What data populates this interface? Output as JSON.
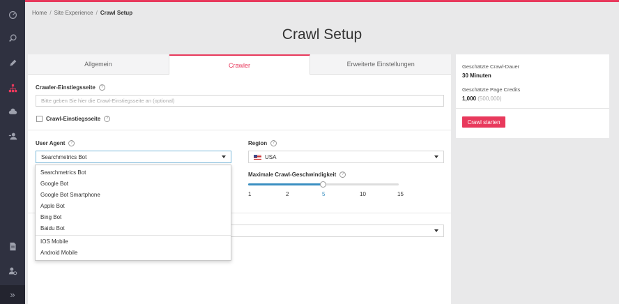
{
  "breadcrumb": {
    "home": "Home",
    "section": "Site Experience",
    "current": "Crawl Setup",
    "separator": "/"
  },
  "page": {
    "title": "Crawl Setup"
  },
  "tabs": [
    {
      "label": "Allgemein",
      "active": false
    },
    {
      "label": "Crawler",
      "active": true
    },
    {
      "label": "Erweiterte Einstellungen",
      "active": false
    }
  ],
  "form": {
    "entry_label": "Crawler-Einstiegsseite",
    "entry_placeholder": "Bitte geben Sie hier die Crawl-Einstiegsseite an (optional)",
    "entry_checkbox_label": "Crawl-Einstiegsseite",
    "help_glyph": "?",
    "user_agent_label": "User Agent",
    "user_agent_value": "Searchmetrics Bot",
    "region_label": "Region",
    "region_value": "USA",
    "speed_label": "Maximale Crawl-Geschwindigkeit",
    "speed_ticks": [
      "1",
      "2",
      "5",
      "10",
      "15"
    ],
    "speed_selected": "5"
  },
  "user_agent_options": [
    "Searchmetrics Bot",
    "Google Bot",
    "Google Bot Smartphone",
    "Apple Bot",
    "Bing Bot",
    "Baidu Bot",
    "IOS Mobile",
    "Android Mobile"
  ],
  "summary": {
    "duration_label": "Geschätzte Crawl-Dauer",
    "duration_value": "30 Minuten",
    "credits_label": "Geschätzte Page Credits",
    "credits_value": "1,000",
    "credits_max": "(500,000)",
    "start_button": "Crawl starten"
  },
  "sidebar": {
    "icons": [
      "speedometer-icon",
      "search-icon",
      "pencil-icon",
      "sitemap-icon",
      "cloud-icon",
      "users-icon",
      "document-icon",
      "user-settings-icon"
    ],
    "expand_glyph": "»"
  },
  "colors": {
    "accent": "#e8395c",
    "sidebar": "#2f3140",
    "slider": "#3a8fc1"
  }
}
